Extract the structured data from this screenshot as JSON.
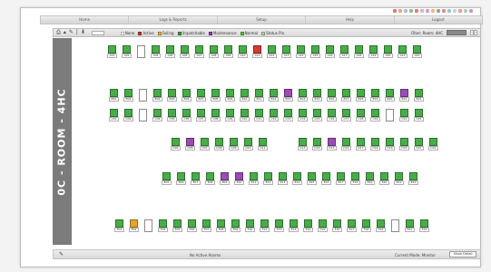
{
  "nav_tabs": [
    "Home",
    "Logs & Reports",
    "Setup",
    "Help",
    "Logout"
  ],
  "toolbar": {
    "tools": [
      "print-icon",
      "arrow-up-icon",
      "pencil-icon",
      "separator",
      "download-icon"
    ],
    "legend": [
      {
        "label": "None",
        "color": "#ffffff"
      },
      {
        "label": "Active",
        "color": "#d93030"
      },
      {
        "label": "Failing",
        "color": "#e5b530"
      },
      {
        "label": "Unpatchable",
        "color": "#3f9b3f"
      },
      {
        "label": "Maintenance",
        "color": "#8e3fa8"
      },
      {
        "label": "Normal",
        "color": "#5fbf4a"
      },
      {
        "label": "Status Pin",
        "color": "#b5d9a5"
      }
    ],
    "filter_label": "Filter: Room: 4HC"
  },
  "room_label": "0C - ROOM - 4HC",
  "status": {
    "message": "No Active Alarms",
    "mode": "Current Mode: Monitor",
    "button": "Show Detail"
  },
  "colors": {
    "green": "#48ad48",
    "purple": "#9a4cb3",
    "red": "#d63a2e",
    "orange": "#e4a62a"
  },
  "seat_rows": [
    {
      "seats": [
        {
          "label": "A01",
          "s": "g"
        },
        {
          "label": "A02",
          "s": "g"
        },
        {
          "label": "",
          "s": "e"
        },
        {
          "label": "A04",
          "s": "g"
        },
        {
          "label": "A05",
          "s": "g"
        },
        {
          "label": "A06",
          "s": "g"
        },
        {
          "label": "A07",
          "s": "g"
        },
        {
          "label": "A08",
          "s": "g"
        },
        {
          "label": "A09",
          "s": "g"
        },
        {
          "label": "A10",
          "s": "g"
        },
        {
          "label": "A11",
          "s": "r"
        },
        {
          "label": "A12",
          "s": "g"
        },
        {
          "label": "A13",
          "s": "g"
        },
        {
          "label": "A14",
          "s": "g"
        },
        {
          "label": "A15",
          "s": "g"
        },
        {
          "label": "A16",
          "s": "g"
        },
        {
          "label": "A17",
          "s": "g"
        },
        {
          "label": "A18",
          "s": "g"
        },
        {
          "label": "A19",
          "s": "g"
        },
        {
          "label": "A20",
          "s": "g"
        },
        {
          "label": "A21",
          "s": "g"
        },
        {
          "label": "A22",
          "s": "g"
        }
      ]
    },
    {
      "seats": [
        {
          "label": "B01",
          "s": "g"
        },
        {
          "label": "B02",
          "s": "g"
        },
        {
          "label": "",
          "s": "e"
        },
        {
          "label": "B04",
          "s": "g"
        },
        {
          "label": "B05",
          "s": "g"
        },
        {
          "label": "B06",
          "s": "g"
        },
        {
          "label": "B07",
          "s": "g"
        },
        {
          "label": "B08",
          "s": "g"
        },
        {
          "label": "B09",
          "s": "g"
        },
        {
          "label": "B10",
          "s": "g"
        },
        {
          "label": "B11",
          "s": "g"
        },
        {
          "label": "B12",
          "s": "g"
        },
        {
          "label": "B13",
          "s": "p"
        },
        {
          "label": "B14",
          "s": "g"
        },
        {
          "label": "B15",
          "s": "g"
        },
        {
          "label": "B16",
          "s": "g"
        },
        {
          "label": "B17",
          "s": "g"
        },
        {
          "label": "B18",
          "s": "g"
        },
        {
          "label": "B19",
          "s": "g"
        },
        {
          "label": "B20",
          "s": "g"
        },
        {
          "label": "B21",
          "s": "p"
        },
        {
          "label": "B22",
          "s": "g"
        }
      ]
    },
    {
      "seats": [
        {
          "label": "C01",
          "s": "g"
        },
        {
          "label": "C02",
          "s": "g"
        },
        {
          "label": "",
          "s": "e"
        },
        {
          "label": "C04",
          "s": "g"
        },
        {
          "label": "C05",
          "s": "g"
        },
        {
          "label": "C06",
          "s": "g"
        },
        {
          "label": "C07",
          "s": "g"
        },
        {
          "label": "C08",
          "s": "g"
        },
        {
          "label": "C09",
          "s": "g"
        },
        {
          "label": "C10",
          "s": "g"
        },
        {
          "label": "C11",
          "s": "g"
        },
        {
          "label": "C12",
          "s": "g"
        },
        {
          "label": "C13",
          "s": "g"
        },
        {
          "label": "C14",
          "s": "g"
        },
        {
          "label": "C15",
          "s": "g"
        },
        {
          "label": "C16",
          "s": "g"
        },
        {
          "label": "C17",
          "s": "g"
        },
        {
          "label": "C18",
          "s": "g"
        },
        {
          "label": "C19",
          "s": "g"
        },
        {
          "label": "",
          "s": "e"
        },
        {
          "label": "C21",
          "s": "g"
        },
        {
          "label": "C22",
          "s": "g"
        }
      ]
    },
    {
      "seats": [
        {
          "label": "D05",
          "s": "g"
        },
        {
          "label": "D06",
          "s": "p"
        },
        {
          "label": "D07",
          "s": "g"
        },
        {
          "label": "D08",
          "s": "g"
        },
        {
          "label": "D09",
          "s": "g"
        },
        {
          "label": "D10",
          "s": "g"
        },
        {
          "label": "D11",
          "s": "g"
        },
        {
          "label": "D13",
          "s": "g"
        },
        {
          "label": "D14",
          "s": "g"
        },
        {
          "label": "D15",
          "s": "p"
        },
        {
          "label": "D16",
          "s": "g"
        },
        {
          "label": "D17",
          "s": "g"
        },
        {
          "label": "D18",
          "s": "g"
        },
        {
          "label": "D19",
          "s": "g"
        },
        {
          "label": "D20",
          "s": "g"
        },
        {
          "label": "D21",
          "s": "g"
        },
        {
          "label": "D22",
          "s": "g"
        }
      ]
    },
    {
      "seats": [
        {
          "label": "E05",
          "s": "g"
        },
        {
          "label": "E06",
          "s": "g"
        },
        {
          "label": "E07",
          "s": "g"
        },
        {
          "label": "E08",
          "s": "g"
        },
        {
          "label": "E09",
          "s": "p"
        },
        {
          "label": "E10",
          "s": "p"
        },
        {
          "label": "E11",
          "s": "g"
        },
        {
          "label": "E12",
          "s": "g"
        },
        {
          "label": "E13",
          "s": "g"
        },
        {
          "label": "E14",
          "s": "g"
        },
        {
          "label": "E15",
          "s": "g"
        },
        {
          "label": "E16",
          "s": "g"
        },
        {
          "label": "E17",
          "s": "g"
        },
        {
          "label": "E18",
          "s": "g"
        },
        {
          "label": "E19",
          "s": "g"
        },
        {
          "label": "E20",
          "s": "g"
        },
        {
          "label": "E21",
          "s": "g"
        },
        {
          "label": "E22",
          "s": "g"
        }
      ]
    },
    {
      "seats": [
        {
          "label": "F01",
          "s": "g"
        },
        {
          "label": "F02",
          "s": "o"
        },
        {
          "label": "",
          "s": "e"
        },
        {
          "label": "F04",
          "s": "g"
        },
        {
          "label": "F05",
          "s": "g"
        },
        {
          "label": "F06",
          "s": "g"
        },
        {
          "label": "F07",
          "s": "g"
        },
        {
          "label": "F08",
          "s": "g"
        },
        {
          "label": "F09",
          "s": "g"
        },
        {
          "label": "F10",
          "s": "g"
        },
        {
          "label": "F11",
          "s": "g"
        },
        {
          "label": "F12",
          "s": "g"
        },
        {
          "label": "F13",
          "s": "g"
        },
        {
          "label": "F14",
          "s": "g"
        },
        {
          "label": "F15",
          "s": "g"
        },
        {
          "label": "F16",
          "s": "g"
        },
        {
          "label": "F17",
          "s": "g"
        },
        {
          "label": "F18",
          "s": "g"
        },
        {
          "label": "F19",
          "s": "g"
        },
        {
          "label": "",
          "s": "e"
        },
        {
          "label": "F21",
          "s": "g"
        },
        {
          "label": "F22",
          "s": "g"
        }
      ]
    }
  ]
}
